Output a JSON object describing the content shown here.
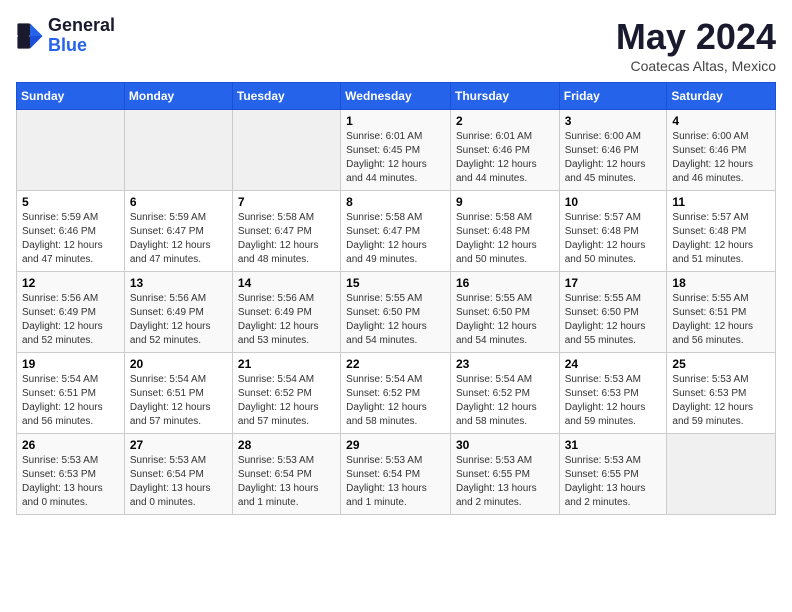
{
  "logo": {
    "general": "General",
    "blue": "Blue"
  },
  "title": "May 2024",
  "subtitle": "Coatecas Altas, Mexico",
  "days_of_week": [
    "Sunday",
    "Monday",
    "Tuesday",
    "Wednesday",
    "Thursday",
    "Friday",
    "Saturday"
  ],
  "weeks": [
    [
      {
        "day": "",
        "info": ""
      },
      {
        "day": "",
        "info": ""
      },
      {
        "day": "",
        "info": ""
      },
      {
        "day": "1",
        "info": "Sunrise: 6:01 AM\nSunset: 6:45 PM\nDaylight: 12 hours\nand 44 minutes."
      },
      {
        "day": "2",
        "info": "Sunrise: 6:01 AM\nSunset: 6:46 PM\nDaylight: 12 hours\nand 44 minutes."
      },
      {
        "day": "3",
        "info": "Sunrise: 6:00 AM\nSunset: 6:46 PM\nDaylight: 12 hours\nand 45 minutes."
      },
      {
        "day": "4",
        "info": "Sunrise: 6:00 AM\nSunset: 6:46 PM\nDaylight: 12 hours\nand 46 minutes."
      }
    ],
    [
      {
        "day": "5",
        "info": "Sunrise: 5:59 AM\nSunset: 6:46 PM\nDaylight: 12 hours\nand 47 minutes."
      },
      {
        "day": "6",
        "info": "Sunrise: 5:59 AM\nSunset: 6:47 PM\nDaylight: 12 hours\nand 47 minutes."
      },
      {
        "day": "7",
        "info": "Sunrise: 5:58 AM\nSunset: 6:47 PM\nDaylight: 12 hours\nand 48 minutes."
      },
      {
        "day": "8",
        "info": "Sunrise: 5:58 AM\nSunset: 6:47 PM\nDaylight: 12 hours\nand 49 minutes."
      },
      {
        "day": "9",
        "info": "Sunrise: 5:58 AM\nSunset: 6:48 PM\nDaylight: 12 hours\nand 50 minutes."
      },
      {
        "day": "10",
        "info": "Sunrise: 5:57 AM\nSunset: 6:48 PM\nDaylight: 12 hours\nand 50 minutes."
      },
      {
        "day": "11",
        "info": "Sunrise: 5:57 AM\nSunset: 6:48 PM\nDaylight: 12 hours\nand 51 minutes."
      }
    ],
    [
      {
        "day": "12",
        "info": "Sunrise: 5:56 AM\nSunset: 6:49 PM\nDaylight: 12 hours\nand 52 minutes."
      },
      {
        "day": "13",
        "info": "Sunrise: 5:56 AM\nSunset: 6:49 PM\nDaylight: 12 hours\nand 52 minutes."
      },
      {
        "day": "14",
        "info": "Sunrise: 5:56 AM\nSunset: 6:49 PM\nDaylight: 12 hours\nand 53 minutes."
      },
      {
        "day": "15",
        "info": "Sunrise: 5:55 AM\nSunset: 6:50 PM\nDaylight: 12 hours\nand 54 minutes."
      },
      {
        "day": "16",
        "info": "Sunrise: 5:55 AM\nSunset: 6:50 PM\nDaylight: 12 hours\nand 54 minutes."
      },
      {
        "day": "17",
        "info": "Sunrise: 5:55 AM\nSunset: 6:50 PM\nDaylight: 12 hours\nand 55 minutes."
      },
      {
        "day": "18",
        "info": "Sunrise: 5:55 AM\nSunset: 6:51 PM\nDaylight: 12 hours\nand 56 minutes."
      }
    ],
    [
      {
        "day": "19",
        "info": "Sunrise: 5:54 AM\nSunset: 6:51 PM\nDaylight: 12 hours\nand 56 minutes."
      },
      {
        "day": "20",
        "info": "Sunrise: 5:54 AM\nSunset: 6:51 PM\nDaylight: 12 hours\nand 57 minutes."
      },
      {
        "day": "21",
        "info": "Sunrise: 5:54 AM\nSunset: 6:52 PM\nDaylight: 12 hours\nand 57 minutes."
      },
      {
        "day": "22",
        "info": "Sunrise: 5:54 AM\nSunset: 6:52 PM\nDaylight: 12 hours\nand 58 minutes."
      },
      {
        "day": "23",
        "info": "Sunrise: 5:54 AM\nSunset: 6:52 PM\nDaylight: 12 hours\nand 58 minutes."
      },
      {
        "day": "24",
        "info": "Sunrise: 5:53 AM\nSunset: 6:53 PM\nDaylight: 12 hours\nand 59 minutes."
      },
      {
        "day": "25",
        "info": "Sunrise: 5:53 AM\nSunset: 6:53 PM\nDaylight: 12 hours\nand 59 minutes."
      }
    ],
    [
      {
        "day": "26",
        "info": "Sunrise: 5:53 AM\nSunset: 6:53 PM\nDaylight: 13 hours\nand 0 minutes."
      },
      {
        "day": "27",
        "info": "Sunrise: 5:53 AM\nSunset: 6:54 PM\nDaylight: 13 hours\nand 0 minutes."
      },
      {
        "day": "28",
        "info": "Sunrise: 5:53 AM\nSunset: 6:54 PM\nDaylight: 13 hours\nand 1 minute."
      },
      {
        "day": "29",
        "info": "Sunrise: 5:53 AM\nSunset: 6:54 PM\nDaylight: 13 hours\nand 1 minute."
      },
      {
        "day": "30",
        "info": "Sunrise: 5:53 AM\nSunset: 6:55 PM\nDaylight: 13 hours\nand 2 minutes."
      },
      {
        "day": "31",
        "info": "Sunrise: 5:53 AM\nSunset: 6:55 PM\nDaylight: 13 hours\nand 2 minutes."
      },
      {
        "day": "",
        "info": ""
      }
    ]
  ]
}
